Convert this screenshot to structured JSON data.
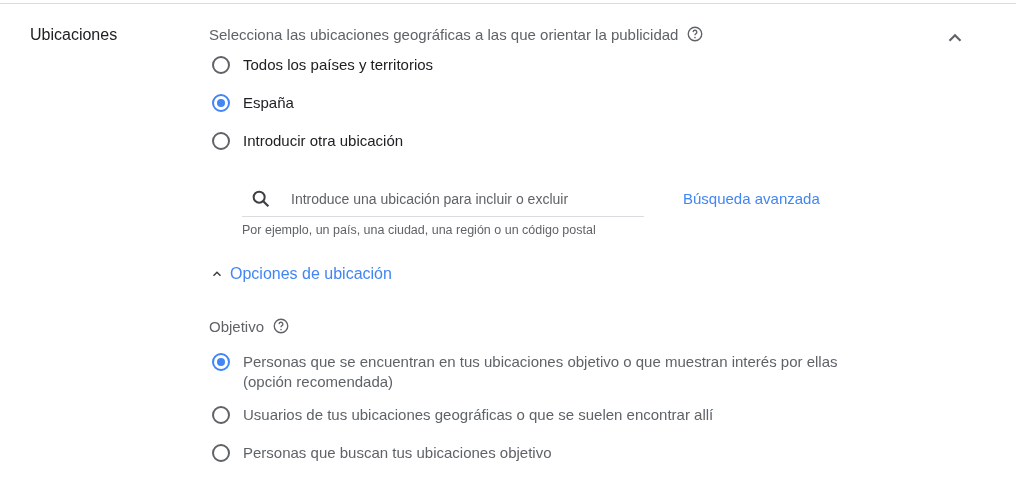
{
  "section": {
    "label": "Ubicaciones",
    "description": "Selecciona las ubicaciones geográficas a las que orientar la publicidad",
    "expanded": true
  },
  "locations": [
    {
      "label": "Todos los países y territorios",
      "selected": false
    },
    {
      "label": "España",
      "selected": true
    },
    {
      "label": "Introducir otra ubicación",
      "selected": false
    }
  ],
  "search": {
    "placeholder": "Introduce una ubicación para incluir o excluir",
    "hint": "Por ejemplo, un país, una ciudad, una región o un código postal",
    "advanced_link": "Búsqueda avanzada"
  },
  "location_options": {
    "label": "Opciones de ubicación",
    "expanded": true
  },
  "target": {
    "label": "Objetivo",
    "options": [
      {
        "label": "Personas que se encuentran en tus ubicaciones objetivo o que muestran interés por ellas (opción recomendada)",
        "selected": true
      },
      {
        "label": "Usuarios de tus ubicaciones geográficas o que se suelen encontrar allí",
        "selected": false
      },
      {
        "label": "Personas que buscan tus ubicaciones objetivo",
        "selected": false
      }
    ]
  }
}
